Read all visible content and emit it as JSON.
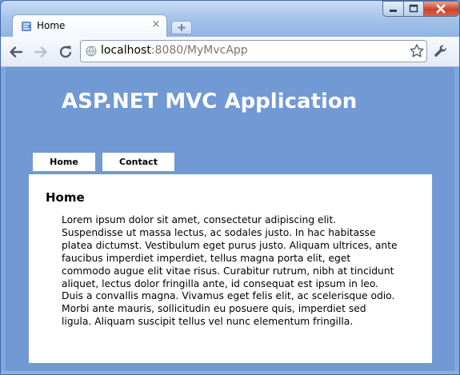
{
  "browser": {
    "tab_title": "Home",
    "tab_close": "×",
    "address": {
      "host": "localhost",
      "rest": ":8080/MyMvcApp"
    }
  },
  "page": {
    "site_title": "ASP.NET MVC Application",
    "menu": [
      {
        "label": "Home"
      },
      {
        "label": "Contact"
      }
    ],
    "heading": "Home",
    "body_text": "Lorem ipsum dolor sit amet, consectetur adipiscing elit. Suspendisse ut massa lectus, ac sodales justo. In hac habitasse platea dictumst. Vestibulum eget purus justo. Aliquam ultrices, ante faucibus imperdiet imperdiet, tellus magna porta elit, eget commodo augue elit vitae risus. Curabitur rutrum, nibh at tincidunt aliquet, lectus dolor fringilla ante, id consequat est ipsum in leo. Duis a convallis magna. Vivamus eget felis elit, ac scelerisque odio. Morbi ante mauris, sollicitudin eu posuere quis, imperdiet sed ligula. Aliquam suscipit tellus vel nunc elementum fringilla."
  },
  "colors": {
    "page_background": "#7199d4",
    "content_background": "#ffffff",
    "title_text": "#ffffff"
  }
}
